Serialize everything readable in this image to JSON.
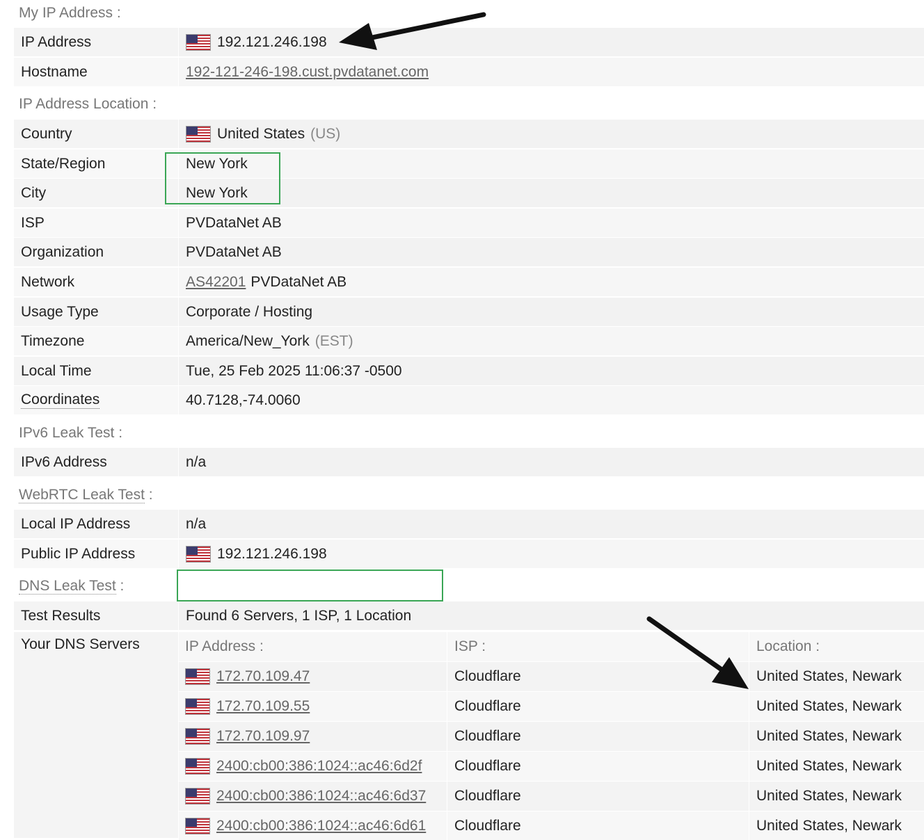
{
  "sections": {
    "my_ip": "My IP Address :",
    "location": "IP Address Location :",
    "ipv6": "IPv6 Leak Test :",
    "webrtc": "WebRTC Leak Test",
    "dns": "DNS Leak Test",
    "colon": ":"
  },
  "my_ip": {
    "ip_label": "IP Address",
    "ip_value": "192.121.246.198",
    "hostname_label": "Hostname",
    "hostname_value": "192-121-246-198.cust.pvdatanet.com"
  },
  "location": {
    "country_label": "Country",
    "country_value": "United States",
    "country_code": "(US)",
    "state_label": "State/Region",
    "state_value": "New York",
    "city_label": "City",
    "city_value": "New York",
    "isp_label": "ISP",
    "isp_value": "PVDataNet AB",
    "org_label": "Organization",
    "org_value": "PVDataNet AB",
    "network_label": "Network",
    "network_as": "AS42201",
    "network_name": "PVDataNet AB",
    "usage_label": "Usage Type",
    "usage_value": "Corporate / Hosting",
    "tz_label": "Timezone",
    "tz_value": "America/New_York",
    "tz_abbr": "(EST)",
    "time_label": "Local Time",
    "time_value": "Tue, 25 Feb 2025 11:06:37 -0500",
    "coords_label": "Coordinates",
    "coords_value": "40.7128,-74.0060"
  },
  "ipv6": {
    "label": "IPv6 Address",
    "value": "n/a"
  },
  "webrtc": {
    "local_label": "Local IP Address",
    "local_value": "n/a",
    "public_label": "Public IP Address",
    "public_value": "192.121.246.198"
  },
  "dns": {
    "results_label": "Test Results",
    "results_value": "Found 6 Servers, 1 ISP, 1 Location",
    "servers_label": "Your DNS Servers",
    "headers": [
      "IP Address :",
      "ISP :",
      "Location :"
    ],
    "rows": [
      {
        "ip": "172.70.109.47",
        "isp": "Cloudflare",
        "location": "United States, Newark"
      },
      {
        "ip": "172.70.109.55",
        "isp": "Cloudflare",
        "location": "United States, Newark"
      },
      {
        "ip": "172.70.109.97",
        "isp": "Cloudflare",
        "location": "United States, Newark"
      },
      {
        "ip": "2400:cb00:386:1024::ac46:6d2f",
        "isp": "Cloudflare",
        "location": "United States, Newark"
      },
      {
        "ip": "2400:cb00:386:1024::ac46:6d37",
        "isp": "Cloudflare",
        "location": "United States, Newark"
      },
      {
        "ip": "2400:cb00:386:1024::ac46:6d61",
        "isp": "Cloudflare",
        "location": "United States, Newark"
      }
    ]
  },
  "icons": {
    "flag": "us-flag-icon"
  },
  "colors": {
    "highlight_box": "#3aa655",
    "arrow": "#111111"
  }
}
